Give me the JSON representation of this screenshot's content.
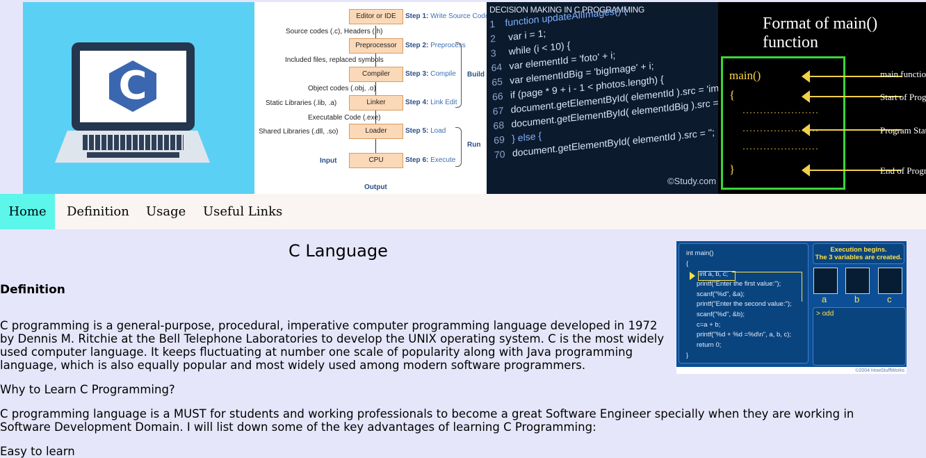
{
  "banner": {
    "laptop": {
      "logo_letter": "C"
    },
    "flow": {
      "boxes": [
        "Editor or IDE",
        "Preprocessor",
        "Compiler",
        "Linker",
        "Loader",
        "CPU"
      ],
      "steps": [
        {
          "num": "Step 1:",
          "text": "Write Source Codes"
        },
        {
          "num": "Step 2:",
          "text": "Preprocess"
        },
        {
          "num": "Step 3:",
          "text": "Compile"
        },
        {
          "num": "Step 4:",
          "text": "Link Edit"
        },
        {
          "num": "Step 5:",
          "text": "Load"
        },
        {
          "num": "Step 6:",
          "text": "Execute"
        }
      ],
      "side_labels": {
        "source": "Source codes (.c), Headers (.h)",
        "included": "Included files, replaced symbols",
        "object": "Object codes (.obj, .o)",
        "static": "Static Libraries (.lib, .a)",
        "executable": "Executable Code (.exe)",
        "shared": "Shared Libraries (.dll, .so)",
        "input": "Input",
        "output": "Output"
      },
      "brackets": {
        "build": "Build",
        "run": "Run"
      }
    },
    "code": {
      "title": "DECISION MAKING IN C PROGRAMMING",
      "lines": [
        {
          "n": "1",
          "t": "function updateAllImages() {"
        },
        {
          "n": "2",
          "t": "    var i = 1;"
        },
        {
          "n": "3",
          "t": "  while (i < 10) {"
        },
        {
          "n": "64",
          "t": "    var elementId = 'foto' + i;"
        },
        {
          "n": "65",
          "t": "    var elementIdBig = 'bigImage' + i;"
        },
        {
          "n": "66",
          "t": "    if (page * 9 + i - 1 < photos.length) {"
        },
        {
          "n": "67",
          "t": "      document.getElementById( elementId ).src = 'images/"
        },
        {
          "n": "68",
          "t": "      document.getElementById( elementIdBig ).src = 'ima"
        },
        {
          "n": "69",
          "t": "    } else {"
        },
        {
          "n": "70",
          "t": "      document.getElementById( elementId ).src = '';"
        }
      ],
      "watermark": "©Study.com"
    },
    "main_fn": {
      "title": "Format of  main() function",
      "code_main": "main()",
      "open_brace": "{",
      "close_brace": "}",
      "dots": "......................",
      "labels": [
        "main function",
        "Start of Program",
        "Program Statements",
        "End of Program"
      ]
    }
  },
  "nav": {
    "items": [
      "Home",
      "Definition",
      "Usage",
      "Useful Links"
    ],
    "active": "Home"
  },
  "content": {
    "title": "C Language",
    "definition_heading": "Definition",
    "para1": "C programming is a general-purpose, procedural, imperative computer programming language developed in 1972 by Dennis M. Ritchie at the Bell Telephone Laboratories to develop the UNIX operating system. C is the most widely used computer language. It keeps fluctuating at number one scale of popularity along with Java programming language, which is also equally popular and most widely used among modern software programmers.",
    "para2": "Why to Learn C Programming?",
    "para3": "C programming language is a MUST for students and working professionals to become a great Software Engineer specially when they are working in Software Development Domain. I will list down some of the key advantages of learning C Programming:",
    "para4": "Easy to learn"
  },
  "side_image": {
    "code": [
      "int main()",
      "{",
      "int a, b, c;",
      "printf(\"Enter the first value:\");",
      "scanf(\"%d\", &a);",
      "printf(\"Enter the second value:\");",
      "scanf(\"%d\", &b);",
      "c=a + b;",
      "printf(\"%d + %d =%d\\n\", a, b, c);",
      "return 0;",
      "}"
    ],
    "exec_line1": "Execution begins.",
    "exec_line2": "The 3 variables are created.",
    "vars": [
      "a",
      "b",
      "c"
    ],
    "output": "> odd",
    "copyright": "©2004 HowStuffWorks"
  }
}
